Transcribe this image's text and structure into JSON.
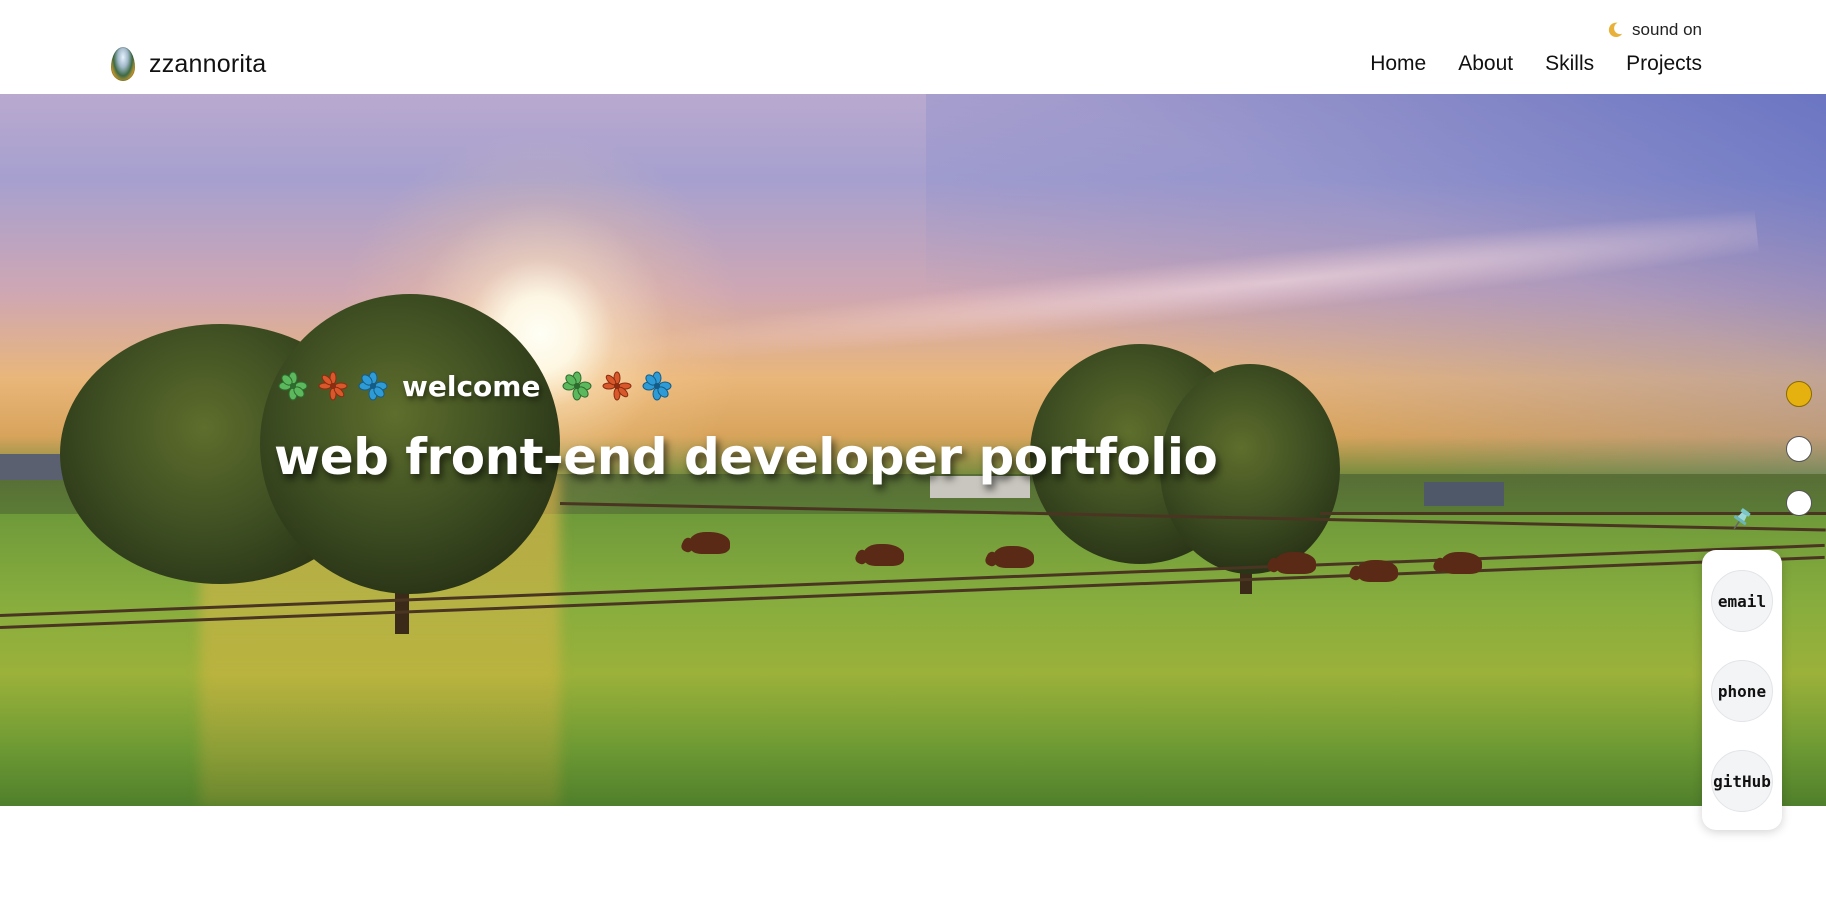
{
  "header": {
    "brand_name": "zzannorita",
    "logo_icon": "egg-logo-icon",
    "sound_label": "sound on",
    "sound_icon": "moon-icon",
    "nav": [
      {
        "label": "Home"
      },
      {
        "label": "About"
      },
      {
        "label": "Skills"
      },
      {
        "label": "Projects"
      }
    ]
  },
  "hero": {
    "welcome_text": "welcome",
    "headline": "web front-end developer portfolio",
    "flower_colors": [
      "#5cb85c",
      "#d9582b",
      "#2f9bd6"
    ]
  },
  "page_indicators": {
    "count": 3,
    "active_index": 0,
    "active_color": "#e5b10f"
  },
  "contact": {
    "pin_icon": "pushpin-icon",
    "buttons": [
      {
        "label": "email"
      },
      {
        "label": "phone"
      },
      {
        "label": "gitHub"
      }
    ]
  }
}
